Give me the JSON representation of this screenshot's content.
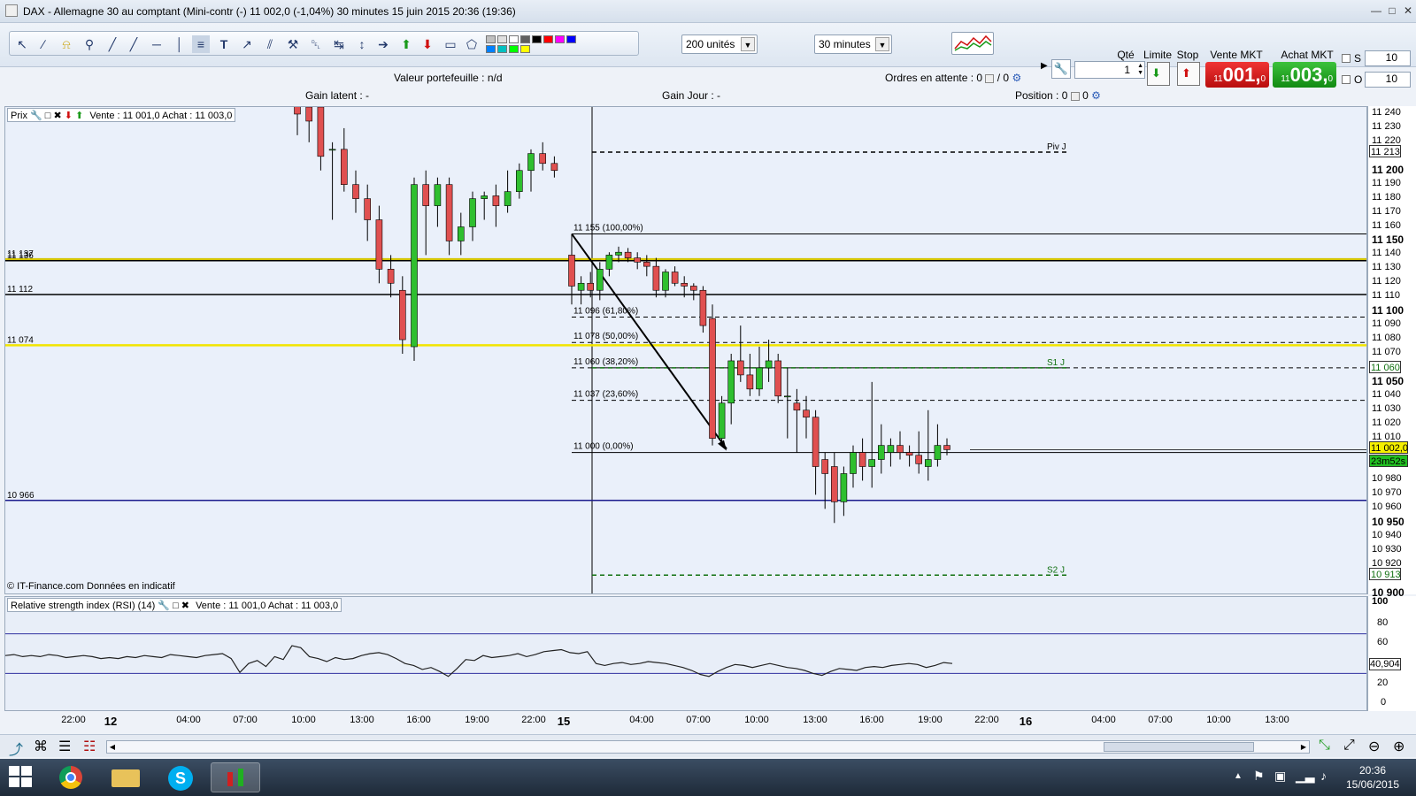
{
  "window": {
    "title": "DAX - Allemagne 30 au comptant (Mini-contr (-)     11 002,0 (-1,04%)     30 minutes  15 juin 2015 20:36 (19:36)",
    "minimize": "—",
    "maximize": "□",
    "close": "✕"
  },
  "toolbar": {
    "units_select": "200 unités",
    "timeframe_select": "30 minutes",
    "qty_label": "Qté",
    "qty_value": "1",
    "limit_label": "Limite",
    "stop_label": "Stop",
    "sell_label": "Vente MKT",
    "sell_price_small": "11",
    "sell_price_big": "001,",
    "sell_price_dec": "0",
    "buy_label": "Achat MKT",
    "buy_price_small": "11",
    "buy_price_big": "003,",
    "buy_price_dec": "0",
    "s_label": "S",
    "s_value": "10",
    "o_label": "O",
    "o_value": "10",
    "colors": [
      "#c0c0c0",
      "#e0e0e0",
      "#ffffff",
      "#606060",
      "#000000",
      "#ff0000",
      "#ff00ff",
      "#0000ff",
      "#0080ff",
      "#00c0c0",
      "#00ff00",
      "#ffff00"
    ]
  },
  "info": {
    "portfolio": "Valeur portefeuille : n/d",
    "pending_orders": "Ordres en attente : 0",
    "pending_sep": "/ 0",
    "gain_latent": "Gain latent : -",
    "gain_jour": "Gain Jour : -",
    "position": "Position : 0",
    "position_sep": "0"
  },
  "main_panel": {
    "tab_label": "Prix",
    "quote": "Vente : 11 001,0 Achat : 11 003,0",
    "copyright": "© IT-Finance.com  Données en indicatif"
  },
  "rsi_panel": {
    "tab_label": "Relative strength index (RSI) (14)",
    "quote": "Vente : 11 001,0 Achat : 11 003,0",
    "ticks": [
      "100",
      "80",
      "60",
      "40",
      "20",
      "0"
    ],
    "current": "40,904"
  },
  "chart_data": {
    "type": "candlestick",
    "ylim": [
      10900,
      11245
    ],
    "yticks": [
      "11 240",
      "11 230",
      "11 220",
      "11 200",
      "11 190",
      "11 180",
      "11 170",
      "11 160",
      "11 150",
      "11 140",
      "11 130",
      "11 120",
      "11 110",
      "11 100",
      "11 090",
      "11 080",
      "11 070",
      "11 050",
      "11 040",
      "11 030",
      "11 020",
      "11 010",
      "10 980",
      "10 970",
      "10 960",
      "10 950",
      "10 940",
      "10 930",
      "10 920",
      "10 900"
    ],
    "ytick_values": [
      11240,
      11230,
      11220,
      11200,
      11190,
      11180,
      11170,
      11160,
      11150,
      11140,
      11130,
      11120,
      11110,
      11100,
      11090,
      11080,
      11070,
      11050,
      11040,
      11030,
      11020,
      11010,
      10980,
      10970,
      10960,
      10950,
      10940,
      10930,
      10920,
      10900
    ],
    "bold_ticks": [
      "11 200",
      "11 150",
      "11 100",
      "11 050",
      "10 950",
      "10 900"
    ],
    "horizontal_lines": [
      {
        "label": "11 137",
        "value": 11137,
        "color": "#d4c400"
      },
      {
        "label": "11 136",
        "value": 11136,
        "color": "#000000"
      },
      {
        "label": "11 112",
        "value": 11112,
        "color": "#000000"
      },
      {
        "label": "11 074",
        "value": 11076,
        "color": "#f2e500"
      },
      {
        "label": "10 966",
        "value": 10966,
        "color": "#1a1a8c"
      }
    ],
    "fibonacci": [
      {
        "label": "11 155 (100,00%)",
        "value": 11155,
        "dashed": false
      },
      {
        "label": "11 096 (61,80%)",
        "value": 11096,
        "dashed": true
      },
      {
        "label": "11 078 (50,00%)",
        "value": 11078,
        "dashed": true
      },
      {
        "label": "11 060 (38,20%)",
        "value": 11060,
        "dashed": true
      },
      {
        "label": "11 037 (23,60%)",
        "value": 11037,
        "dashed": true
      },
      {
        "label": "11 000 (0,00%)",
        "value": 11000,
        "dashed": false
      }
    ],
    "pivots": [
      {
        "label": "Piv J",
        "value": 11213,
        "color": "#000000",
        "box": "11 213"
      },
      {
        "label": "S1 J",
        "value": 11060,
        "color": "#107010",
        "box": "11 060"
      },
      {
        "label": "S2 J",
        "value": 10913,
        "color": "#107010",
        "box": "10 913"
      }
    ],
    "current_price": "11 002,0",
    "current_value": 11002,
    "countdown": "23m52s",
    "xticks": [
      "22:00",
      "12",
      "04:00",
      "07:00",
      "10:00",
      "13:00",
      "16:00",
      "19:00",
      "22:00",
      "15",
      "04:00",
      "07:00",
      "10:00",
      "13:00",
      "16:00",
      "19:00",
      "22:00",
      "16",
      "04:00",
      "07:00",
      "10:00",
      "13:00"
    ],
    "candles": [
      [
        11250,
        11255,
        11225,
        11240
      ],
      [
        11245,
        11250,
        11220,
        11235
      ],
      [
        11245,
        11250,
        11200,
        11210
      ],
      [
        11215,
        11220,
        11165,
        11215
      ],
      [
        11215,
        11230,
        11185,
        11190
      ],
      [
        11190,
        11200,
        11170,
        11180
      ],
      [
        11180,
        11190,
        11150,
        11165
      ],
      [
        11165,
        11175,
        11120,
        11130
      ],
      [
        11130,
        11140,
        11110,
        11120
      ],
      [
        11115,
        11125,
        11070,
        11080
      ],
      [
        11075,
        11195,
        11065,
        11190
      ],
      [
        11190,
        11200,
        11140,
        11175
      ],
      [
        11175,
        11195,
        11160,
        11190
      ],
      [
        11190,
        11195,
        11140,
        11150
      ],
      [
        11150,
        11170,
        11140,
        11160
      ],
      [
        11160,
        11185,
        11150,
        11180
      ],
      [
        11180,
        11185,
        11165,
        11182
      ],
      [
        11182,
        11190,
        11160,
        11175
      ],
      [
        11175,
        11200,
        11170,
        11185
      ],
      [
        11185,
        11205,
        11180,
        11200
      ],
      [
        11200,
        11215,
        11185,
        11212
      ],
      [
        11212,
        11220,
        11200,
        11205
      ],
      [
        11205,
        11210,
        11195,
        11200
      ],
      [
        11140,
        11155,
        11105,
        11118
      ],
      [
        11115,
        11125,
        11105,
        11120
      ],
      [
        11120,
        11128,
        11110,
        11115
      ],
      [
        11115,
        11135,
        11108,
        11130
      ],
      [
        11130,
        11142,
        11125,
        11140
      ],
      [
        11140,
        11146,
        11135,
        11142
      ],
      [
        11142,
        11145,
        11135,
        11138
      ],
      [
        11138,
        11142,
        11130,
        11135
      ],
      [
        11135,
        11140,
        11125,
        11132
      ],
      [
        11132,
        11138,
        11110,
        11115
      ],
      [
        11115,
        11130,
        11110,
        11128
      ],
      [
        11128,
        11132,
        11118,
        11120
      ],
      [
        11120,
        11125,
        11110,
        11118
      ],
      [
        11118,
        11120,
        11108,
        11115
      ],
      [
        11115,
        11118,
        11085,
        11090
      ],
      [
        11095,
        11105,
        11005,
        11010
      ],
      [
        11010,
        11040,
        11005,
        11035
      ],
      [
        11035,
        11070,
        11020,
        11065
      ],
      [
        11065,
        11090,
        11050,
        11055
      ],
      [
        11055,
        11070,
        11040,
        11045
      ],
      [
        11045,
        11075,
        11040,
        11060
      ],
      [
        11060,
        11080,
        11050,
        11065
      ],
      [
        11065,
        11070,
        11035,
        11040
      ],
      [
        11040,
        11060,
        11010,
        11040
      ],
      [
        11035,
        11045,
        11000,
        11030
      ],
      [
        11030,
        11040,
        11010,
        11025
      ],
      [
        11025,
        11030,
        10970,
        10990
      ],
      [
        10995,
        11000,
        10960,
        10985
      ],
      [
        10990,
        11000,
        10950,
        10965
      ],
      [
        10965,
        10990,
        10955,
        10985
      ],
      [
        10985,
        11005,
        10975,
        11000
      ],
      [
        11000,
        11010,
        10980,
        10990
      ],
      [
        10990,
        11050,
        10975,
        10995
      ],
      [
        10995,
        11020,
        10985,
        11005
      ],
      [
        11000,
        11010,
        10990,
        11005
      ],
      [
        11005,
        11015,
        10995,
        11000
      ],
      [
        11000,
        11005,
        10990,
        10998
      ],
      [
        10998,
        11015,
        10985,
        10992
      ],
      [
        10990,
        11030,
        10980,
        10995
      ],
      [
        10995,
        11020,
        10990,
        11005
      ],
      [
        11005,
        11010,
        10998,
        11002
      ]
    ]
  }
}
